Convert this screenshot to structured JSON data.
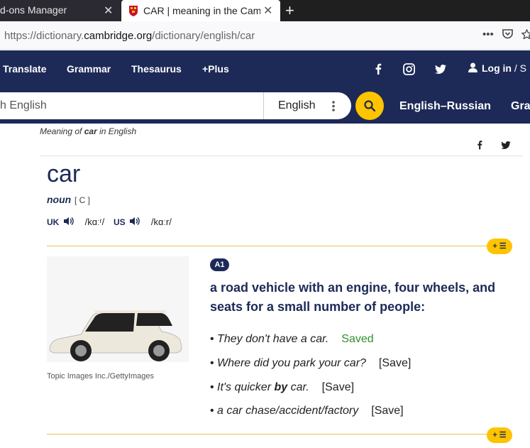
{
  "browser": {
    "tabs": [
      {
        "label": "d-ons Manager",
        "close": "✕"
      },
      {
        "label": "CAR | meaning in the Cam",
        "close": "✕"
      }
    ],
    "new_tab": "+",
    "url_pre": "https://dictionary.",
    "url_host": "cambridge.org",
    "url_path": "/dictionary/english/car",
    "url_icons": [
      "•••",
      "pocket-icon",
      "star-icon"
    ]
  },
  "nav": {
    "items": [
      "Translate",
      "Grammar",
      "Thesaurus",
      "+Plus"
    ],
    "social": [
      "facebook-icon",
      "instagram-icon",
      "twitter-icon"
    ],
    "login": "Log in",
    "login_sep": "/ S"
  },
  "search": {
    "placeholder": "h English",
    "language": "English",
    "links": [
      "English–Russian",
      "Gra"
    ]
  },
  "entry": {
    "breadcrumb_pre": "Meaning of ",
    "breadcrumb_word": "car",
    "breadcrumb_post": " in English",
    "headword": "car",
    "pos": "noun",
    "grammar": "[ C ]",
    "uk_label": "UK",
    "uk_ipa": "/kɑːʳ/",
    "us_label": "US",
    "us_ipa": "/kɑːr/",
    "level": "A1",
    "definition": "a road vehicle with an engine, four wheels, and seats for a small number of people:",
    "image_credit": "Topic Images Inc./GettyImages",
    "plus_label": "+ ☰",
    "examples": [
      {
        "pre": "They don't have a car.",
        "bold": "",
        "post": "",
        "save": "Saved"
      },
      {
        "pre": "Where did you park your car?",
        "bold": "",
        "post": "",
        "save": "[Save]"
      },
      {
        "pre": "It's quicker ",
        "bold": "by",
        "post": " car.",
        "save": "[Save]"
      },
      {
        "pre": "a car chase/accident/factory",
        "bold": "",
        "post": "",
        "save": "[Save]"
      }
    ]
  },
  "colors": {
    "brand": "#1d2a57",
    "accent": "#fec400",
    "saved": "#2f8f2f"
  }
}
